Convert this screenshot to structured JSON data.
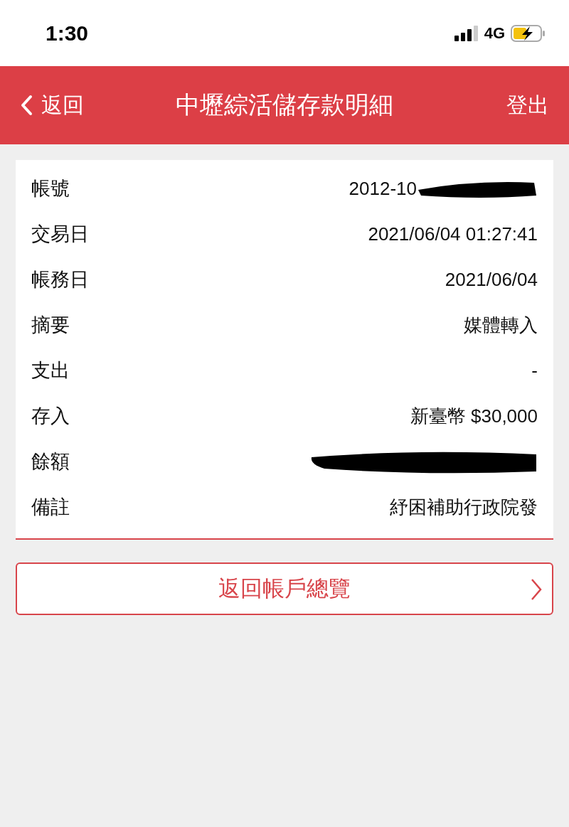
{
  "status_bar": {
    "time": "1:30",
    "network": "4G"
  },
  "header": {
    "back": "返回",
    "title": "中壢綜活儲存款明細",
    "action": "登出"
  },
  "rows": [
    {
      "label": "帳號",
      "value": "2012-10",
      "redacted": true
    },
    {
      "label": "交易日",
      "value": "2021/06/04 01:27:41",
      "redacted": false
    },
    {
      "label": "帳務日",
      "value": "2021/06/04",
      "redacted": false
    },
    {
      "label": "摘要",
      "value": "媒體轉入",
      "redacted": false
    },
    {
      "label": "支出",
      "value": "-",
      "redacted": false
    },
    {
      "label": "存入",
      "value": "新臺幣 $30,000",
      "redacted": false
    },
    {
      "label": "餘額",
      "redacted": true
    },
    {
      "label": "備註",
      "value": "紓困補助行政院發",
      "redacted": false
    }
  ],
  "overview_button": "返回帳戶總覽"
}
